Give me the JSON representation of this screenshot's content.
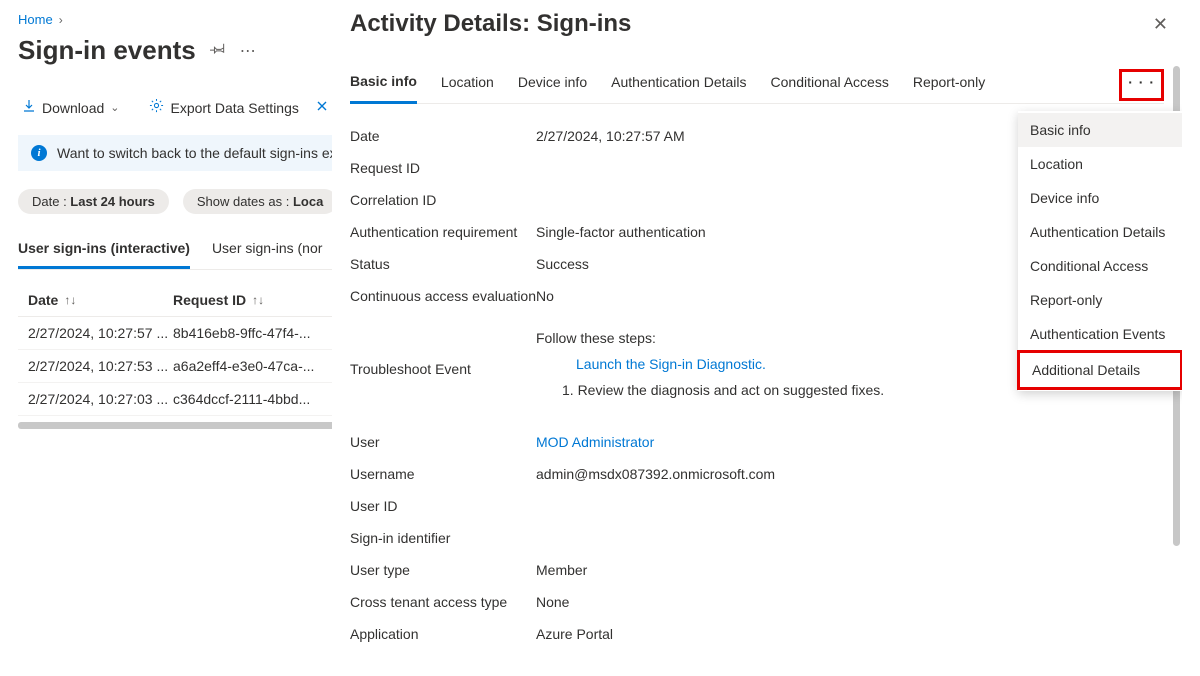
{
  "breadcrumb": {
    "home": "Home"
  },
  "page_title": "Sign-in events",
  "toolbar": {
    "download": "Download",
    "export": "Export Data Settings"
  },
  "info_bar": "Want to switch back to the default sign-ins experi",
  "filters": {
    "date_label": "Date : ",
    "date_value": "Last 24 hours",
    "show_label": "Show dates as : ",
    "show_value": "Loca"
  },
  "page_tabs": {
    "interactive": "User sign-ins (interactive)",
    "noninteractive": "User sign-ins (nor"
  },
  "table": {
    "headers": {
      "date": "Date",
      "request_id": "Request ID"
    },
    "rows": [
      {
        "date": "2/27/2024, 10:27:57 ...",
        "req": "8b416eb8-9ffc-47f4-..."
      },
      {
        "date": "2/27/2024, 10:27:53 ...",
        "req": "a6a2eff4-e3e0-47ca-..."
      },
      {
        "date": "2/27/2024, 10:27:03 ...",
        "req": "c364dccf-2111-4bbd..."
      }
    ]
  },
  "panel": {
    "title": "Activity Details: Sign-ins",
    "tabs": [
      "Basic info",
      "Location",
      "Device info",
      "Authentication Details",
      "Conditional Access",
      "Report-only"
    ],
    "menu": [
      "Basic info",
      "Location",
      "Device info",
      "Authentication Details",
      "Conditional Access",
      "Report-only",
      "Authentication Events",
      "Additional Details"
    ],
    "details": {
      "date_l": "Date",
      "date_v": "2/27/2024, 10:27:57 AM",
      "reqid_l": "Request ID",
      "reqid_v": "",
      "corrid_l": "Correlation ID",
      "corrid_v": "",
      "authreq_l": "Authentication requirement",
      "authreq_v": "Single-factor authentication",
      "status_l": "Status",
      "status_v": "Success",
      "cae_l": "Continuous access evaluation",
      "cae_v": "No",
      "trouble_l": "Troubleshoot Event",
      "trouble_follow": "Follow these steps:",
      "trouble_launch": "Launch the Sign-in Diagnostic.",
      "trouble_step1": "1. Review the diagnosis and act on suggested fixes.",
      "user_l": "User",
      "user_v": "MOD Administrator",
      "uname_l": "Username",
      "uname_v": "admin@msdx087392.onmicrosoft.com",
      "uid_l": "User ID",
      "uid_v": "",
      "signid_l": "Sign-in identifier",
      "signid_v": "",
      "utype_l": "User type",
      "utype_v": "Member",
      "cross_l": "Cross tenant access type",
      "cross_v": "None",
      "app_l": "Application",
      "app_v": "Azure Portal"
    }
  }
}
